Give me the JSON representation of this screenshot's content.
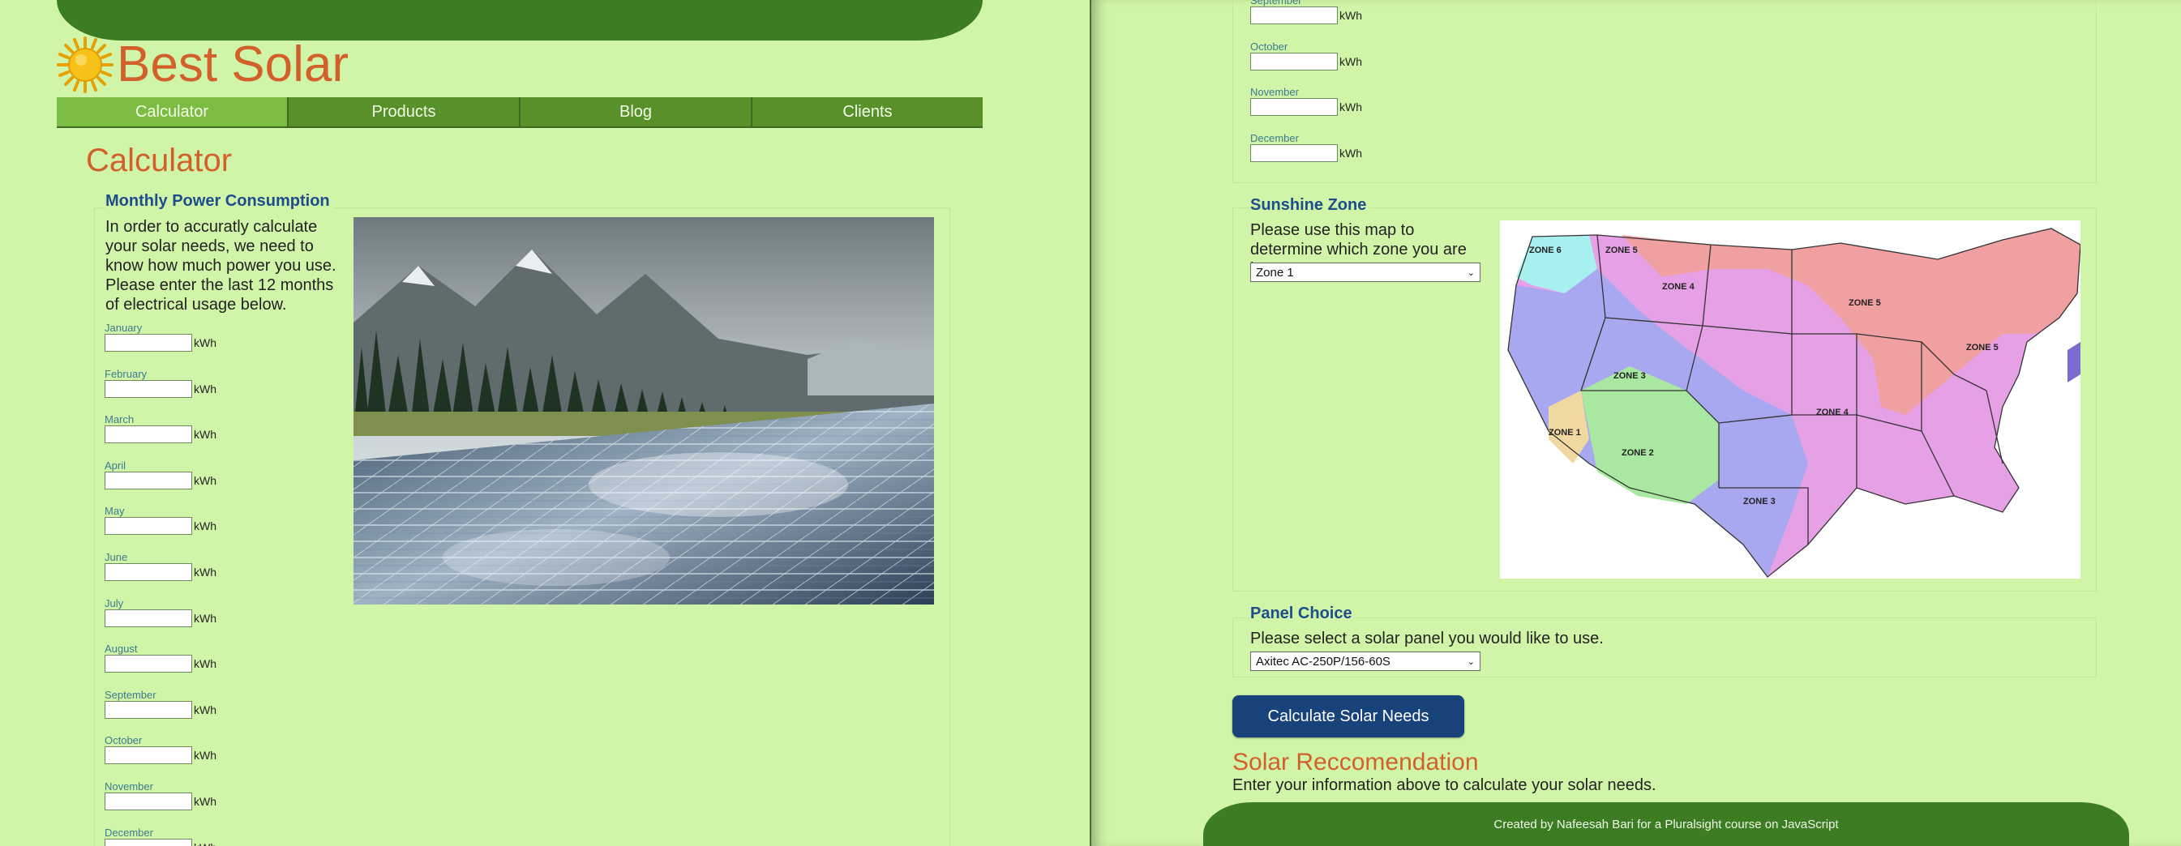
{
  "brand": {
    "name": "Best Solar"
  },
  "nav": {
    "items": [
      {
        "label": "Calculator",
        "active": true
      },
      {
        "label": "Products",
        "active": false
      },
      {
        "label": "Blog",
        "active": false
      },
      {
        "label": "Clients",
        "active": false
      }
    ]
  },
  "page": {
    "title": "Calculator"
  },
  "power": {
    "title": "Monthly Power Consumption",
    "description": "In order to accuratly calculate your solar needs, we need to know how much power you use. Please enter the last 12 months of electrical usage below.",
    "unit": "kWh",
    "months": [
      "January",
      "February",
      "March",
      "April",
      "May",
      "June",
      "July",
      "August",
      "September",
      "October",
      "November",
      "December"
    ]
  },
  "zone": {
    "title": "Sunshine Zone",
    "description": "Please use this map to determine which zone you are in.",
    "selected": "Zone 1",
    "map_labels": [
      "ZONE 6",
      "ZONE 5",
      "ZONE 4",
      "ZONE 5",
      "ZONE 5",
      "ZONE 3",
      "ZONE 4",
      "ZONE 1",
      "ZONE 2",
      "ZONE 3"
    ]
  },
  "panel": {
    "title": "Panel Choice",
    "description": "Please select a solar panel you would like to use.",
    "selected": "Axitec AC-250P/156-60S"
  },
  "calculate_button": "Calculate Solar Needs",
  "result": {
    "title": "Solar Reccomendation",
    "text": "Enter your information above to calculate your solar needs."
  },
  "footer": {
    "text": "Created by Nafeesah Bari for a Pluralsight course on JavaScript"
  },
  "colors": {
    "background": "#d1f5a8",
    "header": "#3c7c22",
    "accent": "#d2602a",
    "section_title": "#1e4d8c",
    "button": "#17427a"
  }
}
